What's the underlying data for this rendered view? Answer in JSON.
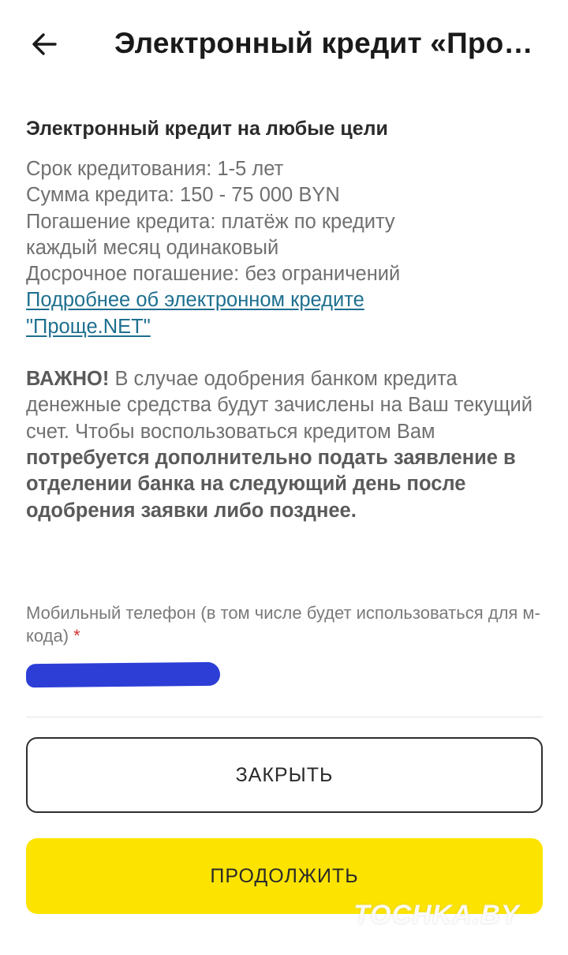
{
  "header": {
    "back_icon": "arrow-left-icon",
    "title": "Электронный кредит «Про…"
  },
  "main": {
    "section_title": "Электронный кредит на любые цели",
    "info_lines": [
      "Срок кредитования: 1-5 лет",
      "Сумма кредита: 150 - 75 000 BYN",
      "Погашение кредита: платёж по кредиту",
      "каждый месяц одинаковый",
      "Досрочное погашение: без ограничений"
    ],
    "more_link_line1": "Подробнее об электронном кредите",
    "more_link_line2": "\"Проще.NET\"",
    "warning_bold": "ВАЖНО!",
    "warning_text": " В случае одобрения банком кредита денежные средства будут зачислены на Ваш текущий счет. Чтобы воспользоваться кредитом Вам ",
    "warning_emphasis": "потребуется дополнительно подать заявление в отделении банка на следующий день после одобрения заявки либо позднее."
  },
  "form": {
    "phone_label": "Мобильный телефон (в том числе будет использоваться для м-кода)",
    "required_mark": "*"
  },
  "actions": {
    "close_label": "ЗАКРЫТЬ",
    "continue_label": "ПРОДОЛЖИТЬ"
  },
  "watermark": "TOCHKA.BY",
  "colors": {
    "accent": "#fde400",
    "link": "#1d6f8f",
    "redaction": "#2d3ed6"
  }
}
